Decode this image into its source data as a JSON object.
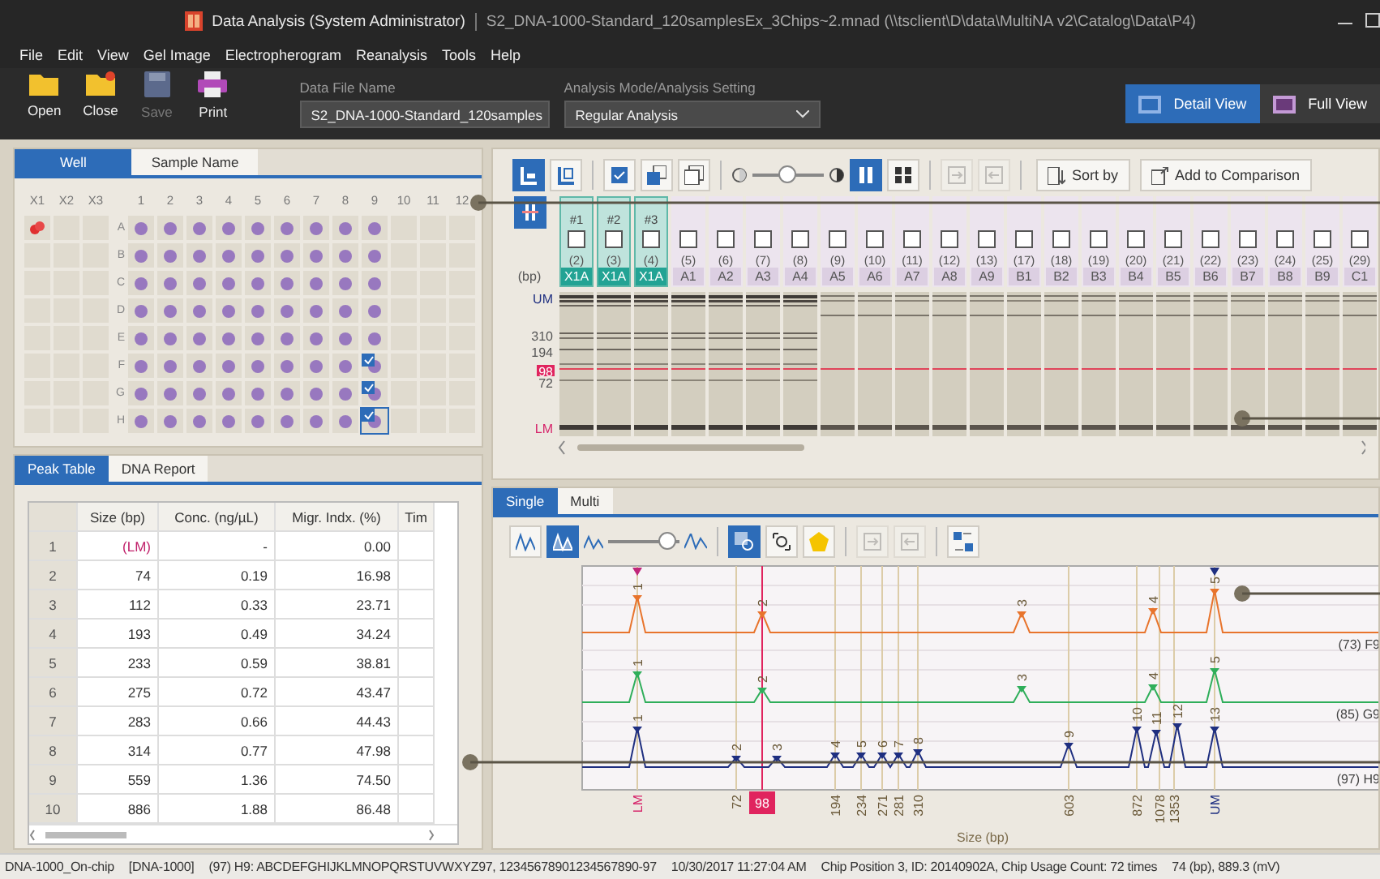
{
  "window": {
    "title": "Data Analysis  (System Administrator)",
    "file": "S2_DNA-1000-Standard_120samplesEx_3Chips~2.mnad (\\\\tsclient\\D\\data\\MultiNA v2\\Catalog\\Data\\P4)"
  },
  "menu": [
    "File",
    "Edit",
    "View",
    "Gel Image",
    "Electropherogram",
    "Reanalysis",
    "Tools",
    "Help"
  ],
  "toolbar": {
    "buttons": [
      {
        "kind": "open",
        "label": "Open",
        "disabled": false
      },
      {
        "kind": "close",
        "label": "Close",
        "disabled": false
      },
      {
        "kind": "save",
        "label": "Save",
        "disabled": true
      },
      {
        "kind": "print",
        "label": "Print",
        "disabled": false
      }
    ],
    "data_file": {
      "label": "Data File Name",
      "value": "S2_DNA-1000-Standard_120samples"
    },
    "analysis": {
      "label": "Analysis Mode/Analysis Setting",
      "value": "Regular Analysis"
    },
    "views": [
      {
        "label": "Detail View",
        "selected": true
      },
      {
        "label": "Full View",
        "selected": false
      }
    ]
  },
  "well_panel": {
    "tabs": [
      {
        "label": "Well",
        "selected": true
      },
      {
        "label": "Sample Name",
        "selected": false
      }
    ],
    "columns": [
      "X1",
      "X2",
      "X3",
      "1",
      "2",
      "3",
      "4",
      "5",
      "6",
      "7",
      "8",
      "9",
      "10",
      "11",
      "12"
    ],
    "rows": [
      {
        "label": "A",
        "cells": [
          {
            "kind": "ladder",
            "selected": false
          },
          {
            "kind": "empty",
            "selected": false
          },
          {
            "kind": "empty",
            "selected": false
          },
          {
            "kind": "sample",
            "selected": false
          },
          {
            "kind": "sample",
            "selected": false
          },
          {
            "kind": "sample",
            "selected": false
          },
          {
            "kind": "sample",
            "selected": false
          },
          {
            "kind": "sample",
            "selected": false
          },
          {
            "kind": "sample",
            "selected": false
          },
          {
            "kind": "sample",
            "selected": false
          },
          {
            "kind": "sample",
            "selected": false
          },
          {
            "kind": "sample",
            "selected": false
          },
          {
            "kind": "empty",
            "selected": false
          },
          {
            "kind": "empty",
            "selected": false
          },
          {
            "kind": "empty",
            "selected": false
          }
        ]
      },
      {
        "label": "B",
        "cells": [
          {
            "kind": "empty",
            "selected": false
          },
          {
            "kind": "empty",
            "selected": false
          },
          {
            "kind": "empty",
            "selected": false
          },
          {
            "kind": "sample",
            "selected": false
          },
          {
            "kind": "sample",
            "selected": false
          },
          {
            "kind": "sample",
            "selected": false
          },
          {
            "kind": "sample",
            "selected": false
          },
          {
            "kind": "sample",
            "selected": false
          },
          {
            "kind": "sample",
            "selected": false
          },
          {
            "kind": "sample",
            "selected": false
          },
          {
            "kind": "sample",
            "selected": false
          },
          {
            "kind": "sample",
            "selected": false
          },
          {
            "kind": "empty",
            "selected": false
          },
          {
            "kind": "empty",
            "selected": false
          },
          {
            "kind": "empty",
            "selected": false
          }
        ]
      },
      {
        "label": "C",
        "cells": [
          {
            "kind": "empty",
            "selected": false
          },
          {
            "kind": "empty",
            "selected": false
          },
          {
            "kind": "empty",
            "selected": false
          },
          {
            "kind": "sample",
            "selected": false
          },
          {
            "kind": "sample",
            "selected": false
          },
          {
            "kind": "sample",
            "selected": false
          },
          {
            "kind": "sample",
            "selected": false
          },
          {
            "kind": "sample",
            "selected": false
          },
          {
            "kind": "sample",
            "selected": false
          },
          {
            "kind": "sample",
            "selected": false
          },
          {
            "kind": "sample",
            "selected": false
          },
          {
            "kind": "sample",
            "selected": false
          },
          {
            "kind": "empty",
            "selected": false
          },
          {
            "kind": "empty",
            "selected": false
          },
          {
            "kind": "empty",
            "selected": false
          }
        ]
      },
      {
        "label": "D",
        "cells": [
          {
            "kind": "empty",
            "selected": false
          },
          {
            "kind": "empty",
            "selected": false
          },
          {
            "kind": "empty",
            "selected": false
          },
          {
            "kind": "sample",
            "selected": false
          },
          {
            "kind": "sample",
            "selected": false
          },
          {
            "kind": "sample",
            "selected": false
          },
          {
            "kind": "sample",
            "selected": false
          },
          {
            "kind": "sample",
            "selected": false
          },
          {
            "kind": "sample",
            "selected": false
          },
          {
            "kind": "sample",
            "selected": false
          },
          {
            "kind": "sample",
            "selected": false
          },
          {
            "kind": "sample",
            "selected": false
          },
          {
            "kind": "empty",
            "selected": false
          },
          {
            "kind": "empty",
            "selected": false
          },
          {
            "kind": "empty",
            "selected": false
          }
        ]
      },
      {
        "label": "E",
        "cells": [
          {
            "kind": "empty",
            "selected": false
          },
          {
            "kind": "empty",
            "selected": false
          },
          {
            "kind": "empty",
            "selected": false
          },
          {
            "kind": "sample",
            "selected": false
          },
          {
            "kind": "sample",
            "selected": false
          },
          {
            "kind": "sample",
            "selected": false
          },
          {
            "kind": "sample",
            "selected": false
          },
          {
            "kind": "sample",
            "selected": false
          },
          {
            "kind": "sample",
            "selected": false
          },
          {
            "kind": "sample",
            "selected": false
          },
          {
            "kind": "sample",
            "selected": false
          },
          {
            "kind": "sample",
            "selected": false
          },
          {
            "kind": "empty",
            "selected": false
          },
          {
            "kind": "empty",
            "selected": false
          },
          {
            "kind": "empty",
            "selected": false
          }
        ]
      },
      {
        "label": "F",
        "cells": [
          {
            "kind": "empty",
            "selected": false
          },
          {
            "kind": "empty",
            "selected": false
          },
          {
            "kind": "empty",
            "selected": false
          },
          {
            "kind": "sample",
            "selected": false
          },
          {
            "kind": "sample",
            "selected": false
          },
          {
            "kind": "sample",
            "selected": false
          },
          {
            "kind": "sample",
            "selected": false
          },
          {
            "kind": "sample",
            "selected": false
          },
          {
            "kind": "sample",
            "selected": false
          },
          {
            "kind": "sample",
            "selected": false
          },
          {
            "kind": "sample",
            "selected": false
          },
          {
            "kind": "marked",
            "selected": false
          },
          {
            "kind": "empty",
            "selected": false
          },
          {
            "kind": "empty",
            "selected": false
          },
          {
            "kind": "empty",
            "selected": false
          }
        ]
      },
      {
        "label": "G",
        "cells": [
          {
            "kind": "empty",
            "selected": false
          },
          {
            "kind": "empty",
            "selected": false
          },
          {
            "kind": "empty",
            "selected": false
          },
          {
            "kind": "sample",
            "selected": false
          },
          {
            "kind": "sample",
            "selected": false
          },
          {
            "kind": "sample",
            "selected": false
          },
          {
            "kind": "sample",
            "selected": false
          },
          {
            "kind": "sample",
            "selected": false
          },
          {
            "kind": "sample",
            "selected": false
          },
          {
            "kind": "sample",
            "selected": false
          },
          {
            "kind": "sample",
            "selected": false
          },
          {
            "kind": "marked",
            "selected": false
          },
          {
            "kind": "empty",
            "selected": false
          },
          {
            "kind": "empty",
            "selected": false
          },
          {
            "kind": "empty",
            "selected": false
          }
        ]
      },
      {
        "label": "H",
        "cells": [
          {
            "kind": "empty",
            "selected": false
          },
          {
            "kind": "empty",
            "selected": false
          },
          {
            "kind": "empty",
            "selected": false
          },
          {
            "kind": "sample",
            "selected": false
          },
          {
            "kind": "sample",
            "selected": false
          },
          {
            "kind": "sample",
            "selected": false
          },
          {
            "kind": "sample",
            "selected": false
          },
          {
            "kind": "sample",
            "selected": false
          },
          {
            "kind": "sample",
            "selected": false
          },
          {
            "kind": "sample",
            "selected": false
          },
          {
            "kind": "sample",
            "selected": false
          },
          {
            "kind": "marked",
            "selected": true
          },
          {
            "kind": "empty",
            "selected": false
          },
          {
            "kind": "empty",
            "selected": false
          },
          {
            "kind": "empty",
            "selected": false
          }
        ]
      }
    ]
  },
  "peak_panel": {
    "tabs": [
      {
        "label": "Peak Table",
        "selected": true
      },
      {
        "label": "DNA Report",
        "selected": false
      }
    ],
    "columns": [
      "Size (bp)",
      "Conc. (ng/µL)",
      "Migr. Indx. (%)",
      "Tim"
    ],
    "rows": [
      {
        "no": "1",
        "size": "(LM)",
        "conc": "-",
        "migr": "0.00",
        "marker": true
      },
      {
        "no": "2",
        "size": "74",
        "conc": "0.19",
        "migr": "16.98",
        "marker": false
      },
      {
        "no": "3",
        "size": "112",
        "conc": "0.33",
        "migr": "23.71",
        "marker": false
      },
      {
        "no": "4",
        "size": "193",
        "conc": "0.49",
        "migr": "34.24",
        "marker": false
      },
      {
        "no": "5",
        "size": "233",
        "conc": "0.59",
        "migr": "38.81",
        "marker": false
      },
      {
        "no": "6",
        "size": "275",
        "conc": "0.72",
        "migr": "43.47",
        "marker": false
      },
      {
        "no": "7",
        "size": "283",
        "conc": "0.66",
        "migr": "44.43",
        "marker": false
      },
      {
        "no": "8",
        "size": "314",
        "conc": "0.77",
        "migr": "47.98",
        "marker": false
      },
      {
        "no": "9",
        "size": "559",
        "conc": "1.36",
        "migr": "74.50",
        "marker": false
      },
      {
        "no": "10",
        "size": "886",
        "conc": "1.88",
        "migr": "86.48",
        "marker": false
      }
    ]
  },
  "gel_panel": {
    "tool_groups": [
      [
        {
          "kind": "lanes",
          "selected": true,
          "disabled": false
        },
        {
          "kind": "lanes-alt",
          "selected": false,
          "disabled": false
        }
      ],
      [
        {
          "kind": "check",
          "selected": false,
          "disabled": false
        },
        {
          "kind": "check-copy",
          "selected": false,
          "disabled": false
        },
        {
          "kind": "copy",
          "selected": false,
          "disabled": false
        }
      ]
    ],
    "contrast": {
      "level": 0.5
    },
    "view_tools": [
      {
        "kind": "columns",
        "selected": true,
        "disabled": false
      },
      {
        "kind": "columns-dense",
        "selected": false,
        "disabled": false
      }
    ],
    "file_tools": [
      {
        "kind": "export",
        "selected": false,
        "disabled": true
      },
      {
        "kind": "import",
        "selected": false,
        "disabled": true
      }
    ],
    "sort_button": "Sort by",
    "compare_button": "Add to Comparison",
    "unit": "(bp)",
    "ruler": [
      {
        "label": "UM",
        "kind": "upper"
      },
      {
        "label": "310",
        "kind": "size"
      },
      {
        "label": "194",
        "kind": "size"
      },
      {
        "label": "98",
        "kind": "cursor"
      },
      {
        "label": "72",
        "kind": "size"
      },
      {
        "label": "LM",
        "kind": "lower"
      }
    ],
    "lanes": [
      {
        "number": "#1",
        "peak": "(2)",
        "well": "X1A",
        "selected": true,
        "checked": false,
        "kind": "dense"
      },
      {
        "number": "#2",
        "peak": "(3)",
        "well": "X1A",
        "selected": true,
        "checked": false,
        "kind": "dense"
      },
      {
        "number": "#3",
        "peak": "(4)",
        "well": "X1A",
        "selected": true,
        "checked": false,
        "kind": "dense"
      },
      {
        "peak": "(5)",
        "well": "A1",
        "selected": false,
        "checked": false,
        "kind": "dense"
      },
      {
        "peak": "(6)",
        "well": "A2",
        "selected": false,
        "checked": false,
        "kind": "dense"
      },
      {
        "peak": "(7)",
        "well": "A3",
        "selected": false,
        "checked": false,
        "kind": "dense"
      },
      {
        "peak": "(8)",
        "well": "A4",
        "selected": false,
        "checked": false,
        "kind": "dense"
      },
      {
        "peak": "(9)",
        "well": "A5",
        "selected": false,
        "checked": false,
        "kind": "light"
      },
      {
        "peak": "(10)",
        "well": "A6",
        "selected": false,
        "checked": false,
        "kind": "light"
      },
      {
        "peak": "(11)",
        "well": "A7",
        "selected": false,
        "checked": false,
        "kind": "light"
      },
      {
        "peak": "(12)",
        "well": "A8",
        "selected": false,
        "checked": false,
        "kind": "light"
      },
      {
        "peak": "(13)",
        "well": "A9",
        "selected": false,
        "checked": false,
        "kind": "light"
      },
      {
        "peak": "(17)",
        "well": "B1",
        "selected": false,
        "checked": false,
        "kind": "light"
      },
      {
        "peak": "(18)",
        "well": "B2",
        "selected": false,
        "checked": false,
        "kind": "light"
      },
      {
        "peak": "(19)",
        "well": "B3",
        "selected": false,
        "checked": false,
        "kind": "light"
      },
      {
        "peak": "(20)",
        "well": "B4",
        "selected": false,
        "checked": false,
        "kind": "light"
      },
      {
        "peak": "(21)",
        "well": "B5",
        "selected": false,
        "checked": false,
        "kind": "light"
      },
      {
        "peak": "(22)",
        "well": "B6",
        "selected": false,
        "checked": false,
        "kind": "light"
      },
      {
        "peak": "(23)",
        "well": "B7",
        "selected": false,
        "checked": false,
        "kind": "light"
      },
      {
        "peak": "(24)",
        "well": "B8",
        "selected": false,
        "checked": false,
        "kind": "light"
      },
      {
        "peak": "(25)",
        "well": "B9",
        "selected": false,
        "checked": false,
        "kind": "light"
      },
      {
        "peak": "(29)",
        "well": "C1",
        "selected": false,
        "checked": false,
        "kind": "light"
      }
    ]
  },
  "electro_panel": {
    "tabs": [
      {
        "label": "Single",
        "selected": true
      },
      {
        "label": "Multi",
        "selected": false
      }
    ],
    "peak_tools": [
      {
        "kind": "peaks",
        "selected": false
      },
      {
        "kind": "peaks-fill",
        "selected": true
      }
    ],
    "scale": {
      "level": 0.85
    },
    "tool_groups": [
      [
        {
          "kind": "zoom",
          "selected": true,
          "disabled": false
        },
        {
          "kind": "fit",
          "selected": false,
          "disabled": false
        },
        {
          "kind": "shape",
          "selected": false,
          "disabled": false
        }
      ],
      [
        {
          "kind": "export",
          "selected": false,
          "disabled": true
        },
        {
          "kind": "import",
          "selected": false,
          "disabled": true
        }
      ],
      [
        {
          "kind": "compare",
          "selected": false,
          "disabled": false
        }
      ]
    ],
    "traces": [
      {
        "label": "(73) F9",
        "color": "#e8742c",
        "peaks": [
          "1",
          "2",
          "3",
          "4",
          "5"
        ]
      },
      {
        "label": "(85) G9",
        "color": "#2fae5a",
        "peaks": [
          "1",
          "2",
          "3",
          "4",
          "5"
        ]
      },
      {
        "label": "(97) H9",
        "color": "#1f2f80",
        "peaks": [
          "1",
          "2",
          "3",
          "4",
          "5",
          "6",
          "7",
          "8",
          "9",
          "10",
          "11",
          "12",
          "13"
        ]
      }
    ],
    "x_labels": [
      {
        "label": "LM",
        "kind": "lower"
      },
      {
        "label": "72",
        "kind": "size"
      },
      {
        "label": "98",
        "kind": "cursor"
      },
      {
        "label": "194",
        "kind": "size"
      },
      {
        "label": "234",
        "kind": "size"
      },
      {
        "label": "271",
        "kind": "size"
      },
      {
        "label": "281",
        "kind": "size"
      },
      {
        "label": "310",
        "kind": "size"
      },
      {
        "label": "603",
        "kind": "size"
      },
      {
        "label": "872",
        "kind": "size"
      },
      {
        "label": "1078",
        "kind": "size"
      },
      {
        "label": "1353",
        "kind": "size"
      },
      {
        "label": "UM",
        "kind": "upper"
      }
    ],
    "x_title": "Size (bp)"
  },
  "status_bar": [
    "DNA-1000_On-chip",
    "[DNA-1000]",
    "(97) H9: ABCDEFGHIJKLMNOPQRSTUVWXYZ97, 12345678901234567890-97",
    "10/30/2017 11:27:04 AM",
    "Chip Position 3, ID: 20140902A, Chip Usage Count: 72 times",
    "74 (bp), 889.3 (mV)"
  ]
}
